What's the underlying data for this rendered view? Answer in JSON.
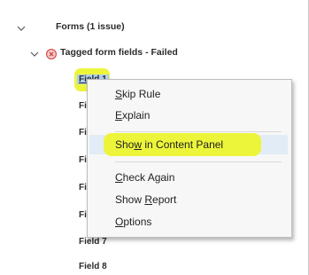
{
  "tree": {
    "forms_label": "Forms (1 issue)",
    "tagged_label": "Tagged form fields - Failed",
    "fields": [
      "Field 1",
      "Fie",
      "Fie",
      "Fie",
      "Fie",
      "Fie",
      "Field 7",
      "Field 8"
    ]
  },
  "context_menu": {
    "items": [
      {
        "pre": "",
        "u": "S",
        "post": "kip Rule"
      },
      {
        "pre": "",
        "u": "E",
        "post": "xplain"
      },
      {
        "pre": "Sho",
        "u": "w",
        "post": " in Content Panel"
      },
      {
        "pre": "",
        "u": "C",
        "post": "heck Again"
      },
      {
        "pre": "Show ",
        "u": "R",
        "post": "eport"
      },
      {
        "pre": "",
        "u": "O",
        "post": "ptions"
      }
    ]
  },
  "colors": {
    "highlight": "#ecf53a",
    "selection": "#aecfee",
    "fail_icon": "#d84a4a"
  }
}
